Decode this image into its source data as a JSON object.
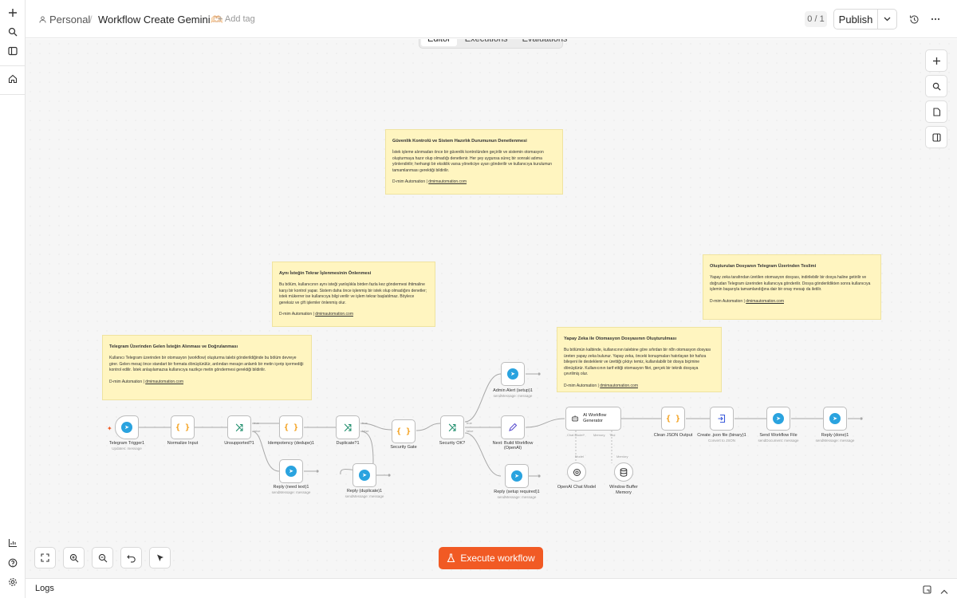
{
  "rail": {
    "icons": [
      "plus-icon",
      "search-icon",
      "panel-icon",
      "home-icon",
      "chart-icon",
      "help-icon",
      "settings-icon"
    ]
  },
  "header": {
    "project": "Personal",
    "separator": "/",
    "workflow_name": "Workflow Create Gemini🫶🏻",
    "add_tag": "+ Add tag",
    "counter": "0 / 1",
    "publish": "Publish"
  },
  "tabs": [
    {
      "label": "Editor",
      "active": true
    },
    {
      "label": "Executions",
      "active": false
    },
    {
      "label": "Evaluations",
      "active": false
    }
  ],
  "stickies": {
    "security": {
      "title": "Güvenlik Kontrolü ve Sistem Hazırlık Durumunun Denetlenmesi",
      "body": "İstek işleme alınmadan önce bir güvenlik kontrolünden geçirilir ve sistemin otomasyon oluşturmaya hazır olup olmadığı denetlenir. Her şey uygunsa süreç bir sonraki adıma yönlendirilir; herhangi bir eksiklik varsa yöneticiye uyarı gönderilir ve kullanıcıya kurulumun tamamlanması gerektiği bildirilir.",
      "footer": "D-mim Automation | ",
      "link": "dmimautomation.com"
    },
    "dedupe": {
      "title": "Aynı İsteğin Tekrar İşlenmesinin Önlenmesi",
      "body": "Bu bölüm, kullanıcının aynı isteği yanlışlıkla birden fazla kez göndermesi ihtimaline karşı bir kontrol yapar. Sistem daha önce işlenmiş bir istek olup olmadığını denetler; istek mükerrer ise kullanıcıya bilgi verilir ve işlem tekrar başlatılmaz. Böylece gereksiz ve çift işlemler önlenmiş olur.",
      "footer": "D-mim Automation | ",
      "link": "dmimautomation.com"
    },
    "telegram_in": {
      "title": "Telegram Üzerinden Gelen İsteğin Alınması ve Doğrulanması",
      "body": "Kullanıcı Telegram üzerinden bir otomasyon (workflow) oluşturma talebi gönderildiğinde bu bölüm devreye girer. Gelen mesaj önce standart bir formata dönüştürülür, ardından mesajın anlamlı bir metin içerip içermediği kontrol edilir. İstek anlaşılamazsa kullanıcıya nazikçe metin göndermesi gerektiği bildirilir.",
      "footer": "D-mim Automation | ",
      "link": "dmimautomation.com"
    },
    "ai_gen": {
      "title": "Yapay Zeka ile Otomasyon Dosyasının Oluşturulması",
      "body": "Bu bölümün kalbinde, kullanıcının talebine göre sıfırdan bir n8n otomasyon dosyası üreten yapay zeka bulunur. Yapay zeka, önceki konuşmaları hatırlayan bir hafıza bileşeni ile desteklenir ve ürettiği çıktıyı temiz, kullanılabilir bir dosya biçimine dönüştürür. Kullanıcının tarif ettiği otomasyon fikri, gerçek bir teknik dosyaya çevrilmiş olur.",
      "footer": "D-mim Automation | ",
      "link": "dmimautomation.com"
    },
    "telegram_out": {
      "title": "Oluşturulan Dosyanın Telegram Üzerinden Teslimi",
      "body": "Yapay zeka tarafından üretilen otomasyon dosyası, indirilebilir bir dosya haline getirilir ve doğrudan Telegram üzerinden kullanıcıya gönderilir. Dosya gönderildikten sonra kullanıcıya işlemin başarıyla tamamlandığına dair bir onay mesajı da iletilir.",
      "footer": "D-mim Automation | ",
      "link": "dmimautomation.com"
    }
  },
  "nodes": {
    "telegram_trigger": {
      "label": "Telegram Trigger1",
      "sub": "Updates: message"
    },
    "normalize": {
      "label": "Normalize Input"
    },
    "unsupported": {
      "label": "Unsupported?1"
    },
    "idempotency": {
      "label": "Idempotency (dedupe)1"
    },
    "duplicate": {
      "label": "Duplicate?1"
    },
    "security_gate": {
      "label": "Security Gate"
    },
    "security_ok": {
      "label": "Security OK?"
    },
    "admin_alert": {
      "label": "Admin Alert (setup)1",
      "sub": "sendMessage: message"
    },
    "build_workflow": {
      "label": "Next: Build Workflow (OpenAI)"
    },
    "reply_setup": {
      "label": "Reply (setup required)1",
      "sub": "sendMessage: message"
    },
    "reply_need_text": {
      "label": "Reply (need text)1",
      "sub": "sendMessage: message"
    },
    "reply_duplicate": {
      "label": "Reply (duplicate)1",
      "sub": "sendMessage: message"
    },
    "ai_generator": {
      "label": "AI Workflow Generator"
    },
    "openai_model": {
      "label": "OpenAI Chat Model"
    },
    "window_memory": {
      "label": "Window Buffer Memory"
    },
    "clean_json": {
      "label": "Clean JSON Output"
    },
    "create_json": {
      "label": "Create .json file (binary)1",
      "sub": "Convert to JSON"
    },
    "send_file": {
      "label": "Send Workflow File",
      "sub": "sendDocument: message"
    },
    "reply_done": {
      "label": "Reply (done)1",
      "sub": "sendMessage: message"
    }
  },
  "ports": {
    "true": "true",
    "false": "false",
    "chat_model": "Chat Model*",
    "memory": "Memory",
    "tool": "Tool",
    "model": "Model",
    "memory2": "Memory"
  },
  "controls": {
    "execute": "Execute workflow"
  },
  "logs": {
    "label": "Logs"
  },
  "colors": {
    "accent": "#f15a24",
    "telegram": "#2aa3df",
    "sticky": "#fff5c0",
    "switch": "#1b8c6a",
    "code": "#f39c12"
  }
}
